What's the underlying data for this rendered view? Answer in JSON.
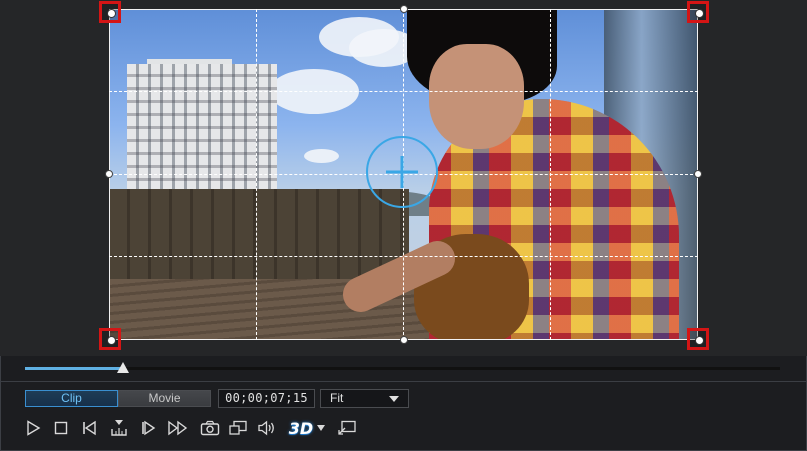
{
  "preview": {
    "progress_percent": 13
  },
  "tabs": {
    "clip_label": "Clip",
    "movie_label": "Movie",
    "active": "Clip"
  },
  "timecode": "00;00;07;15",
  "zoom_select": {
    "value": "Fit"
  },
  "controls": {
    "three_d_label": "3D",
    "items": [
      "play-icon",
      "stop-icon",
      "previous-frame-icon",
      "split-icon",
      "next-frame-icon",
      "fast-forward-icon",
      "snapshot-icon",
      "display-mode-icon",
      "volume-icon",
      "3d-icon",
      "3d-dropdown-icon",
      "undock-icon"
    ]
  },
  "colors": {
    "accent": "#5fb0e3",
    "corner_highlight": "#d41515",
    "crosshair": "#3aa7e6"
  }
}
